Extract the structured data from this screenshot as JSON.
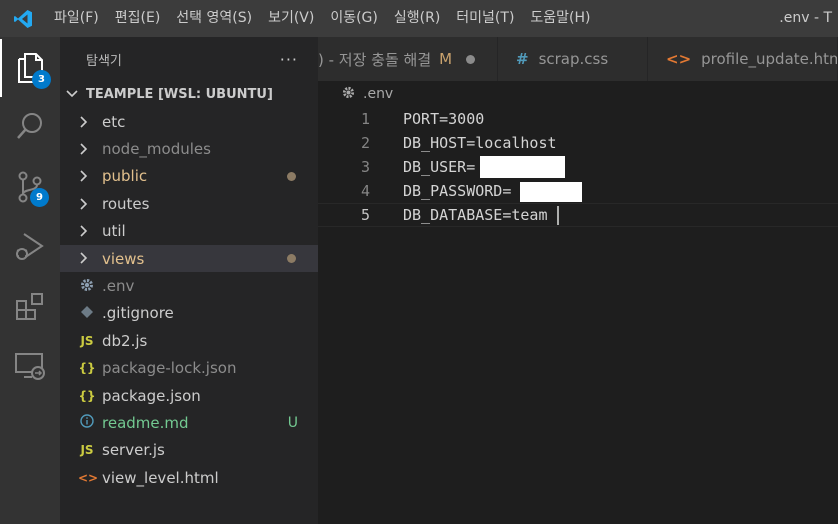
{
  "titlebar": {
    "menu": [
      "파일(F)",
      "편집(E)",
      "선택 영역(S)",
      "보기(V)",
      "이동(G)",
      "실행(R)",
      "터미널(T)",
      "도움말(H)"
    ],
    "window_title": ".env - T"
  },
  "activity": {
    "explorer_badge": "3",
    "scm_badge": "9"
  },
  "sidebar": {
    "title": "탐색기",
    "more": "···",
    "folder": "TEAMPLE [WSL: UBUNTU]",
    "items": [
      {
        "label": "etc",
        "color": "#cccccc"
      },
      {
        "label": "node_modules",
        "color": "#8c8c8c"
      },
      {
        "label": "public",
        "color": "#e2c08d"
      },
      {
        "label": "routes",
        "color": "#cccccc"
      },
      {
        "label": "util",
        "color": "#cccccc"
      },
      {
        "label": "views",
        "color": "#e2c08d"
      },
      {
        "label": ".env",
        "color": "#8c8c8c"
      },
      {
        "label": ".gitignore",
        "color": "#cccccc"
      },
      {
        "label": "db2.js",
        "color": "#cccccc"
      },
      {
        "label": "package-lock.json",
        "color": "#8c8c8c"
      },
      {
        "label": "package.json",
        "color": "#cccccc"
      },
      {
        "label": "readme.md",
        "color": "#73c991"
      },
      {
        "label": "server.js",
        "color": "#cccccc"
      },
      {
        "label": "view_level.html",
        "color": "#cccccc"
      }
    ],
    "readme_status": "U"
  },
  "tabs": {
    "tab1_label": ") - 저장 충돌 해결",
    "tab1_mod": "M",
    "tab2_label": "scrap.css",
    "tab3_label": "profile_update.html"
  },
  "breadcrumb": {
    "file": ".env"
  },
  "editor": {
    "lines": [
      {
        "num": "1",
        "text": "PORT=3000"
      },
      {
        "num": "2",
        "text": "DB_HOST=localhost"
      },
      {
        "num": "3",
        "text": "DB_USER="
      },
      {
        "num": "4",
        "text": "DB_PASSWORD="
      },
      {
        "num": "5",
        "text": "DB_DATABASE=team"
      }
    ]
  }
}
